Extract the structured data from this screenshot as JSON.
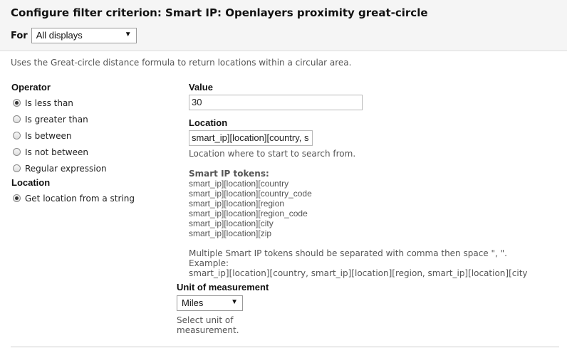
{
  "header": {
    "title": "Configure filter criterion: Smart IP: Openlayers proximity great-circle",
    "for_label": "For",
    "for_select_value": "All displays"
  },
  "description": "Uses the Great-circle distance formula to return locations within a circular area.",
  "operator": {
    "label": "Operator",
    "options": [
      {
        "label": "Is less than",
        "checked": true
      },
      {
        "label": "Is greater than",
        "checked": false
      },
      {
        "label": "Is between",
        "checked": false
      },
      {
        "label": "Is not between",
        "checked": false
      },
      {
        "label": "Regular expression",
        "checked": false
      }
    ]
  },
  "location_source": {
    "label": "Location",
    "options": [
      {
        "label": "Get location from a string",
        "checked": true
      }
    ]
  },
  "value": {
    "label": "Value",
    "input_value": "30"
  },
  "location": {
    "label": "Location",
    "input_value": "smart_ip][location][country, s",
    "help": "Location where to start to search from."
  },
  "tokens": {
    "title": "Smart IP tokens:",
    "items": [
      "smart_ip][location][country",
      "smart_ip][location][country_code",
      "smart_ip][location][region",
      "smart_ip][location][region_code",
      "smart_ip][location][city",
      "smart_ip][location][zip"
    ],
    "note_line1": "Multiple Smart IP tokens should be separated with comma then space \", \". Example:",
    "note_line2": "smart_ip][location][country, smart_ip][location][region, smart_ip][location][city"
  },
  "unit": {
    "label": "Unit of measurement",
    "select_value": "Miles",
    "help_line1": "Select unit of",
    "help_line2": "measurement."
  }
}
